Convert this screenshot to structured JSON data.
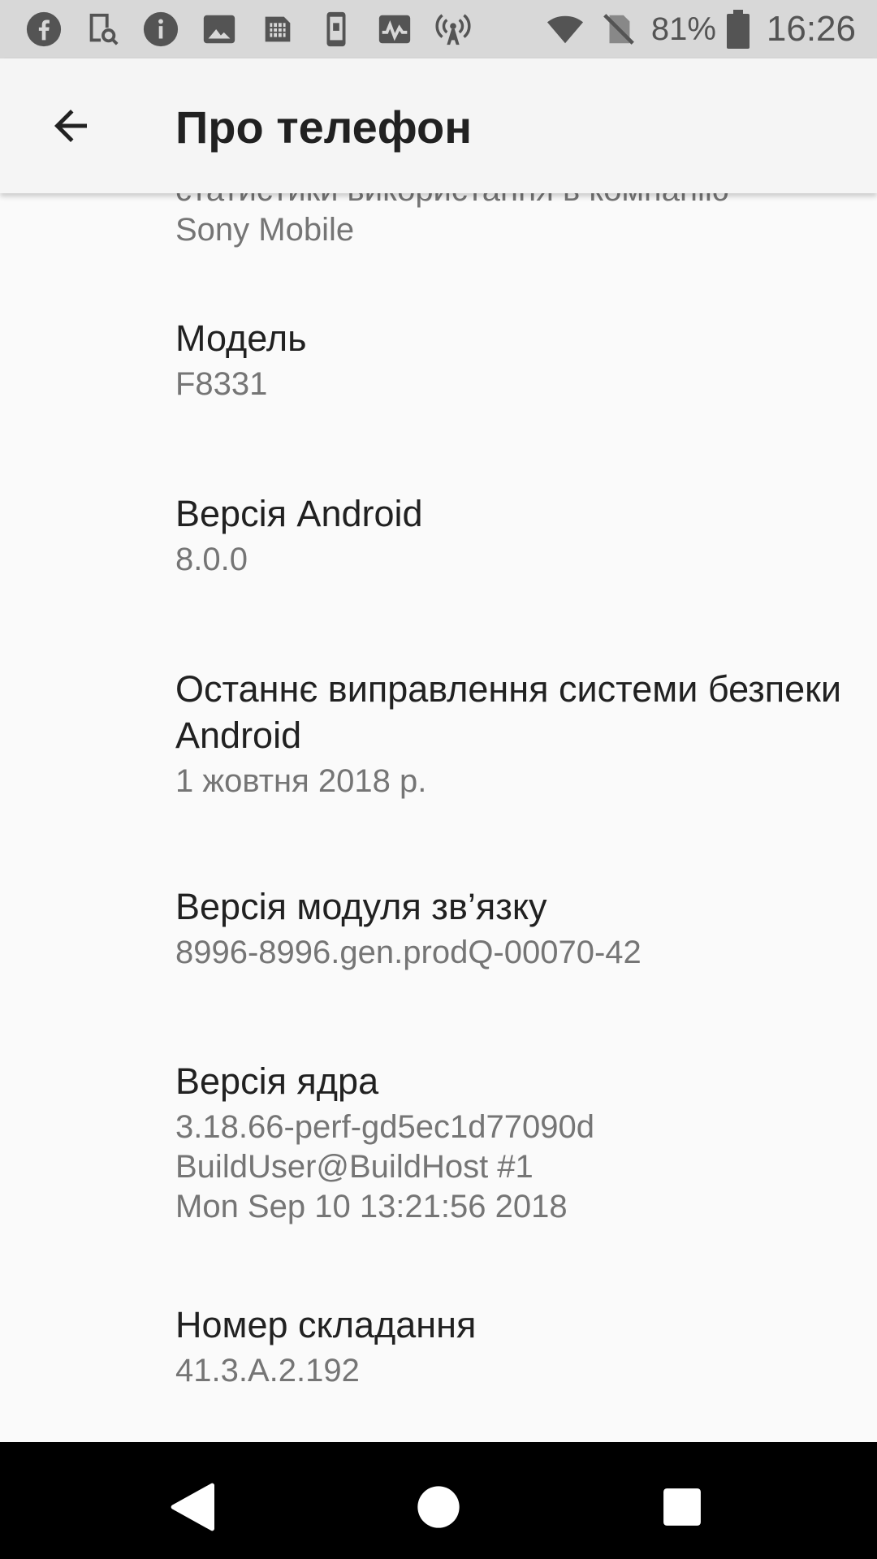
{
  "status_bar": {
    "left_icons": [
      "facebook-icon",
      "device-search-icon",
      "info-icon",
      "image-icon",
      "sim-card-icon",
      "phone-device-icon",
      "activity-chart-icon",
      "signal-broadcast-icon"
    ],
    "battery_percent": "81%",
    "time": "16:26"
  },
  "app_bar": {
    "title": "Про телефон"
  },
  "settings": {
    "partial_subtitle_line1": "статистики використання в компанію",
    "partial_subtitle_line2": "Sony Mobile",
    "items": [
      {
        "title": "Модель",
        "value": "F8331"
      },
      {
        "title": "Версія Android",
        "value": "8.0.0"
      },
      {
        "title": "Останнє виправлення системи безпеки Android",
        "value": "1 жовтня 2018 р."
      },
      {
        "title": "Версія модуля зв’язку",
        "value": "8996-8996.gen.prodQ-00070-42"
      },
      {
        "title": "Версія ядра",
        "value": "3.18.66-perf-gd5ec1d77090d\nBuildUser@BuildHost #1\nMon Sep 10 13:21:56 2018"
      },
      {
        "title": "Номер складання",
        "value": "41.3.A.2.192"
      }
    ]
  },
  "colors": {
    "status_bar_bg": "#d8d8d8",
    "app_bar_bg": "#f5f5f5",
    "background": "#fafafa",
    "primary_text": "#212121",
    "secondary_text": "#757575",
    "nav_bar_bg": "#000000"
  }
}
